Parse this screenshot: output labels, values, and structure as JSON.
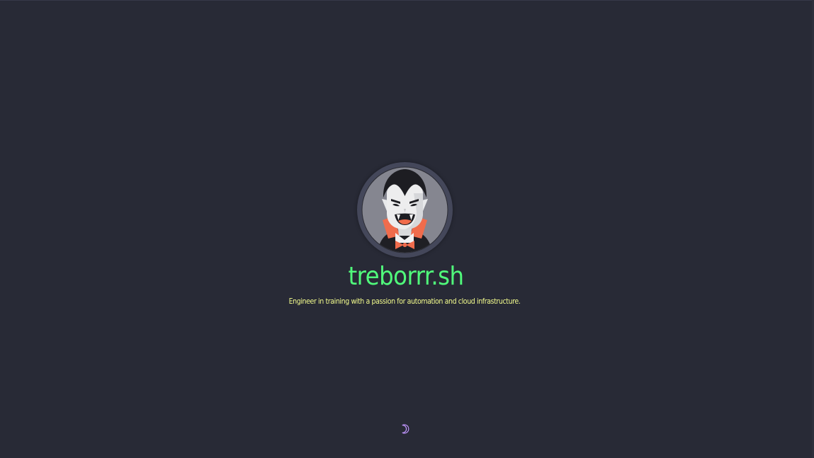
{
  "avatar": {
    "icon": "vampire-avatar-icon"
  },
  "title": "treborrr.sh",
  "tagline": "Engineer in training with a passion for automation and cloud infrastructure.",
  "theme_toggle": {
    "icon": "moon-icon",
    "color": "#bd93f9"
  },
  "colors": {
    "background": "#282a36",
    "title": "#50fa7b",
    "tagline": "#f1fa8c",
    "avatar_ring": "#44475a"
  }
}
